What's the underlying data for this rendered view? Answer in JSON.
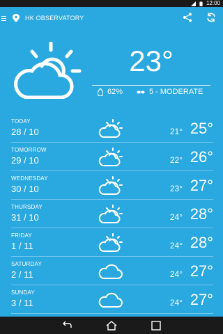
{
  "status_bar": {
    "time": "12:00"
  },
  "header": {
    "location": "HK OBSERVATORY"
  },
  "current": {
    "temperature": "23°",
    "humidity": "62%",
    "uv": "5 - MODERATE"
  },
  "forecast": [
    {
      "day": "TODAY",
      "date": "28 / 10",
      "low": "21°",
      "high": "25°",
      "icon": "sun-cloud-icon"
    },
    {
      "day": "TOMORROW",
      "date": "29 / 10",
      "low": "22°",
      "high": "26°",
      "icon": "sun-cloud-icon"
    },
    {
      "day": "WEDNESDAY",
      "date": "30 / 10",
      "low": "23°",
      "high": "27°",
      "icon": "sun-cloud-icon"
    },
    {
      "day": "THURSDAY",
      "date": "31 / 10",
      "low": "24°",
      "high": "28°",
      "icon": "sun-cloud-icon"
    },
    {
      "day": "FRIDAY",
      "date": "1 / 11",
      "low": "24°",
      "high": "28°",
      "icon": "sun-cloud-icon"
    },
    {
      "day": "SATURDAY",
      "date": "2 / 11",
      "low": "24°",
      "high": "27°",
      "icon": "cloud-icon"
    },
    {
      "day": "SUNDAY",
      "date": "3 / 11",
      "low": "24°",
      "high": "27°",
      "icon": "cloud-icon"
    }
  ]
}
